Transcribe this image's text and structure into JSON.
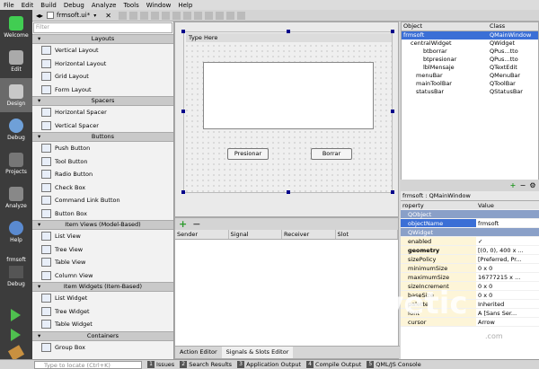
{
  "menu": [
    "File",
    "Edit",
    "Build",
    "Debug",
    "Analyze",
    "Tools",
    "Window",
    "Help"
  ],
  "modes": [
    {
      "label": "Welcome",
      "icon": "qt-welcome-icon"
    },
    {
      "label": "Edit",
      "icon": "edit-icon"
    },
    {
      "label": "Design",
      "icon": "design-icon"
    },
    {
      "label": "Debug",
      "icon": "debug-icon"
    },
    {
      "label": "Projects",
      "icon": "projects-icon"
    },
    {
      "label": "Analyze",
      "icon": "analyze-icon"
    },
    {
      "label": "Help",
      "icon": "help-icon"
    }
  ],
  "project_label": "frmsoft",
  "project_sub": "Debug",
  "file_tab": "frmsoft.ui*",
  "filter_placeholder": "Filter",
  "widgetbox": [
    {
      "cat": "Layouts",
      "items": [
        "Vertical Layout",
        "Horizontal Layout",
        "Grid Layout",
        "Form Layout"
      ]
    },
    {
      "cat": "Spacers",
      "items": [
        "Horizontal Spacer",
        "Vertical Spacer"
      ]
    },
    {
      "cat": "Buttons",
      "items": [
        "Push Button",
        "Tool Button",
        "Radio Button",
        "Check Box",
        "Command Link Button",
        "Button Box"
      ]
    },
    {
      "cat": "Item Views (Model-Based)",
      "items": [
        "List View",
        "Tree View",
        "Table View",
        "Column View"
      ]
    },
    {
      "cat": "Item Widgets (Item-Based)",
      "items": [
        "List Widget",
        "Tree Widget",
        "Table Widget"
      ]
    },
    {
      "cat": "Containers",
      "items": [
        "Group Box"
      ]
    }
  ],
  "form": {
    "type_here": "Type Here",
    "btn_presionar": "Presionar",
    "btn_borrar": "Borrar"
  },
  "signals": {
    "headers": [
      "Sender",
      "Signal",
      "Receiver",
      "Slot"
    ],
    "tabs": [
      "Action Editor",
      "Signals & Slots Editor"
    ]
  },
  "objects": {
    "headers": [
      "Object",
      "Class"
    ],
    "rows": [
      [
        "frmsoft",
        "QMainWindow"
      ],
      [
        "centralWidget",
        "QWidget"
      ],
      [
        "btborrar",
        "QPus...tto"
      ],
      [
        "btpresionar",
        "QPus...tto"
      ],
      [
        "lblMensaje",
        "QTextEdit"
      ],
      [
        "menuBar",
        "QMenuBar"
      ],
      [
        "mainToolBar",
        "QToolBar"
      ],
      [
        "statusBar",
        "QStatusBar"
      ]
    ]
  },
  "prop_title": "frmsoft : QMainWindow",
  "props": {
    "headers": [
      "roperty",
      "Value"
    ],
    "rows": [
      [
        "QObject",
        ""
      ],
      [
        "objectName",
        "frmsoft"
      ],
      [
        "QWidget",
        ""
      ],
      [
        "enabled",
        "✓"
      ],
      [
        "geometry",
        "[(0, 0), 400 x ..."
      ],
      [
        "sizePolicy",
        "[Preferred, Pr..."
      ],
      [
        "minimumSize",
        "0 x 0"
      ],
      [
        "maximumSize",
        "16777215 x ..."
      ],
      [
        "sizeIncrement",
        "0 x 0"
      ],
      [
        "baseSize",
        "0 x 0"
      ],
      [
        "palette",
        "Inherited"
      ],
      [
        "font",
        "A  [Sans Ser..."
      ],
      [
        "cursor",
        "Arrow"
      ]
    ]
  },
  "locator_placeholder": "Type to locate (Ctrl+K)",
  "status": [
    {
      "n": "1",
      "l": "Issues"
    },
    {
      "n": "2",
      "l": "Search Results"
    },
    {
      "n": "3",
      "l": "Application Output"
    },
    {
      "n": "4",
      "l": "Compile Output"
    },
    {
      "n": "5",
      "l": "QML/JS Console"
    }
  ],
  "watermark": "solvetic",
  "watermark_com": ".com"
}
